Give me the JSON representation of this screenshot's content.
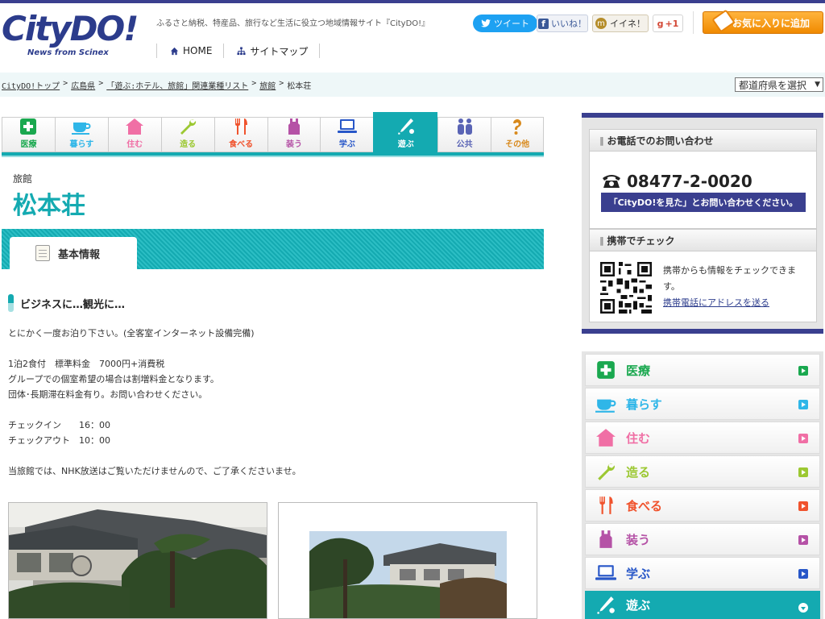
{
  "header": {
    "logo_word": "CityDO!",
    "logo_sub": "News from Scinex",
    "tagline": "ふるさと納税、特産品、旅行など生活に役立つ地域情報サイト『CityDO!』",
    "nav": [
      {
        "label": "HOME"
      },
      {
        "label": "サイトマップ"
      }
    ],
    "social": {
      "tweet": "ツイート",
      "like": "いいね！",
      "mixi": "イイネ！",
      "gplus": "+1"
    },
    "favorite": "お気に入りに追加"
  },
  "breadcrumb": [
    {
      "label": "CityDO!トップ"
    },
    {
      "label": "広島県"
    },
    {
      "label": "「遊ぶ:ホテル、旅館」関連業種リスト"
    },
    {
      "label": "旅館"
    },
    {
      "label": "松本荘"
    }
  ],
  "pref_select": "都道府県を選択",
  "categories": [
    {
      "label": "医療",
      "color": "#1aa84f"
    },
    {
      "label": "暮らす",
      "color": "#2fb6e8"
    },
    {
      "label": "住む",
      "color": "#f06fa5"
    },
    {
      "label": "造る",
      "color": "#9cc832"
    },
    {
      "label": "食べる",
      "color": "#f0532d"
    },
    {
      "label": "装う",
      "color": "#b552a6"
    },
    {
      "label": "学ぶ",
      "color": "#2857c8"
    },
    {
      "label": "遊ぶ",
      "color": "#ffffff"
    },
    {
      "label": "公共",
      "color": "#5a64b5"
    },
    {
      "label": "その他",
      "color": "#d88a1e"
    }
  ],
  "listing": {
    "genre": "旅館",
    "name": "松本荘",
    "tab": "基本情報",
    "subheading": "ビジネスに…観光に…",
    "lines": [
      "とにかく一度お泊り下さい。(全客室インターネット設備完備)",
      "",
      "1泊2食付　標準料金　7000円+消費税",
      "グループでの個室希望の場合は割増料金となります。",
      "団体･長期滞在料金有り。お問い合わせください。",
      "",
      "チェックイン　　16：00",
      "チェックアウト　10：00",
      "",
      "当旅館では、NHK放送はご覧いただけませんので、ご了承くださいませ。"
    ]
  },
  "sidebar": {
    "phone_heading": "お電話でのお問い合わせ",
    "phone": "08477-2-0020",
    "phone_note": "「CityDO!を見た」とお問い合わせください。",
    "mobile_heading": "携帯でチェック",
    "mobile_text": "携帯からも情報をチェックできます。",
    "mobile_link": "携帯電話にアドレスを送る",
    "menu": [
      {
        "label": "医療",
        "color": "#1aa84f"
      },
      {
        "label": "暮らす",
        "color": "#2fb6e8"
      },
      {
        "label": "住む",
        "color": "#f06fa5"
      },
      {
        "label": "造る",
        "color": "#9cc832"
      },
      {
        "label": "食べる",
        "color": "#f0532d"
      },
      {
        "label": "装う",
        "color": "#b552a6"
      },
      {
        "label": "学ぶ",
        "color": "#2857c8"
      },
      {
        "label": "遊ぶ",
        "color": "#14aab1"
      }
    ]
  }
}
